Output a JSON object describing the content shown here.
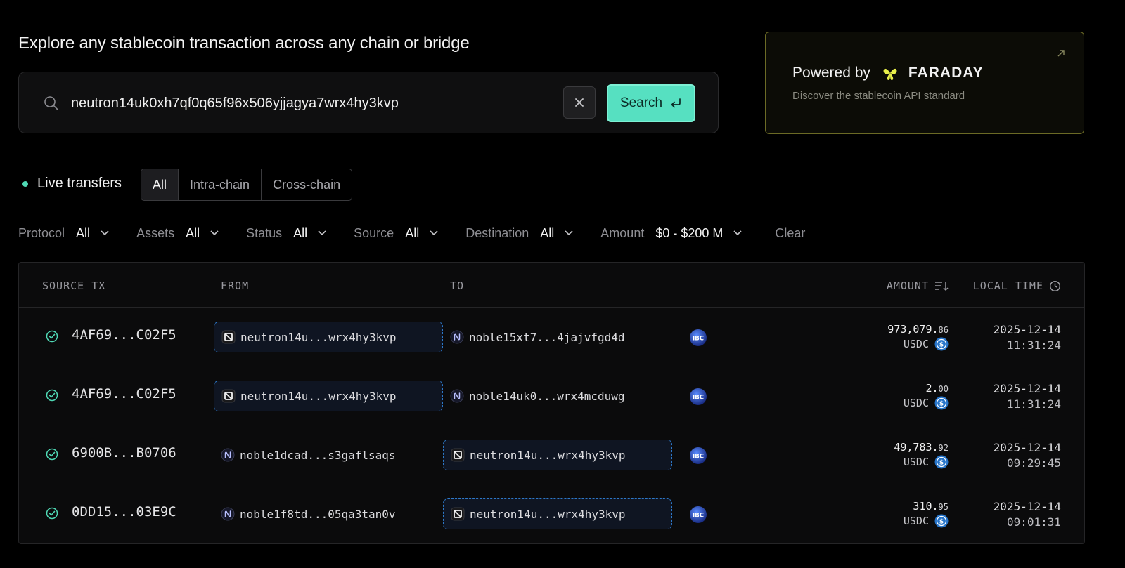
{
  "header": {
    "title": "Explore any stablecoin transaction across any chain or bridge"
  },
  "search": {
    "value": "neutron14uk0xh7qf0q65f96x506yjjagya7wrx4hy3kvp",
    "button_label": "Search"
  },
  "promo": {
    "powered_by": "Powered by",
    "brand": "FARADAY",
    "subtitle": "Discover the stablecoin API standard",
    "brand_color": "#e9f04a"
  },
  "live": {
    "label": "Live transfers",
    "tabs": [
      "All",
      "Intra-chain",
      "Cross-chain"
    ],
    "selected_tab": "All"
  },
  "filters": [
    {
      "label": "Protocol",
      "value": "All"
    },
    {
      "label": "Assets",
      "value": "All"
    },
    {
      "label": "Status",
      "value": "All"
    },
    {
      "label": "Source",
      "value": "All"
    },
    {
      "label": "Destination",
      "value": "All"
    },
    {
      "label": "Amount",
      "value": "$0 - $200 M"
    }
  ],
  "clear_label": "Clear",
  "table": {
    "columns": {
      "source_tx": "SOURCE TX",
      "from": "FROM",
      "to": "TO",
      "amount": "AMOUNT",
      "local_time": "LOCAL TIME"
    },
    "rows": [
      {
        "tx": "4AF69...C02F5",
        "from": "neutron14u...wrx4hy3kvp",
        "from_chain": "neutron",
        "to": "noble15xt7...4jajvfgd4d",
        "to_chain": "noble",
        "protocol": "IBC",
        "amount_int": "973,079.",
        "amount_dec": "86",
        "asset": "USDC",
        "date": "2025-12-14",
        "time": "11:31:24",
        "highlight": "from"
      },
      {
        "tx": "4AF69...C02F5",
        "from": "neutron14u...wrx4hy3kvp",
        "from_chain": "neutron",
        "to": "noble14uk0...wrx4mcduwg",
        "to_chain": "noble",
        "protocol": "IBC",
        "amount_int": "2.",
        "amount_dec": "00",
        "asset": "USDC",
        "date": "2025-12-14",
        "time": "11:31:24",
        "highlight": "from"
      },
      {
        "tx": "6900B...B0706",
        "from": "noble1dcad...s3gaflsaqs",
        "from_chain": "noble",
        "to": "neutron14u...wrx4hy3kvp",
        "to_chain": "neutron",
        "protocol": "IBC",
        "amount_int": "49,783.",
        "amount_dec": "92",
        "asset": "USDC",
        "date": "2025-12-14",
        "time": "09:29:45",
        "highlight": "to"
      },
      {
        "tx": "0DD15...03E9C",
        "from": "noble1f8td...05qa3tan0v",
        "from_chain": "noble",
        "to": "neutron14u...wrx4hy3kvp",
        "to_chain": "neutron",
        "protocol": "IBC",
        "amount_int": "310.",
        "amount_dec": "95",
        "asset": "USDC",
        "date": "2025-12-14",
        "time": "09:01:31",
        "highlight": "to"
      }
    ]
  },
  "colors": {
    "accent": "#56e0c1",
    "status_ok": "#4fd9b5",
    "highlight_border": "#2d78c8",
    "usdc": "#2775ca"
  }
}
